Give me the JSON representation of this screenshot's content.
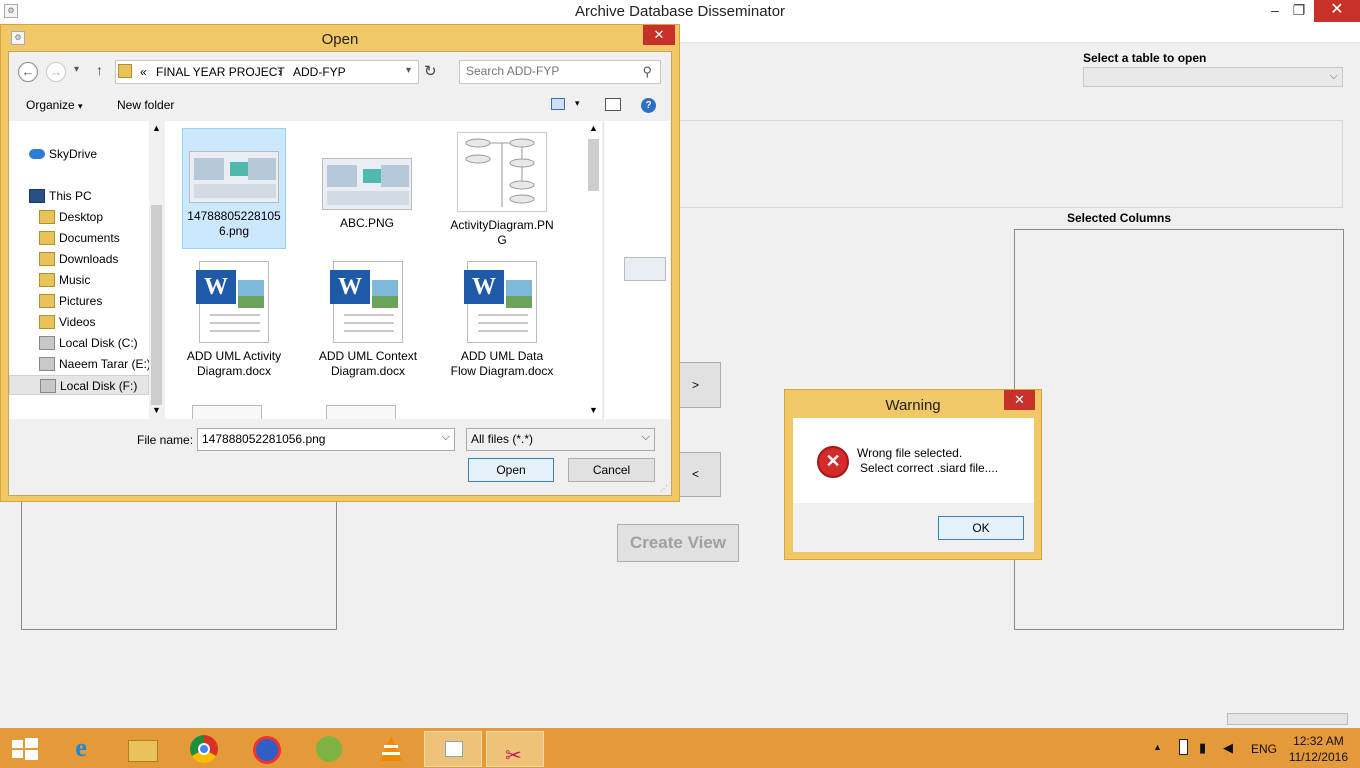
{
  "app": {
    "title": "Archive Database Disseminator",
    "select_table_label": "Select a table to open",
    "selected_columns_label": "Selected Columns",
    "move_right_label": ">",
    "move_left_label": "<",
    "create_view_label": "Create View"
  },
  "open_dialog": {
    "title": "Open",
    "breadcrumb": [
      "«",
      "FINAL YEAR PROJECT",
      "›",
      "ADD-FYP"
    ],
    "search_placeholder": "Search ADD-FYP",
    "organize_label": "Organize",
    "new_folder_label": "New folder",
    "nav_items": [
      "SkyDrive",
      "This PC",
      "Desktop",
      "Documents",
      "Downloads",
      "Music",
      "Pictures",
      "Videos",
      "Local Disk (C:)",
      "Naeem Tarar (E:)",
      "Local Disk (F:)"
    ],
    "files": [
      {
        "name": "147888052281056.png",
        "type": "png"
      },
      {
        "name": "ABC.PNG",
        "type": "png"
      },
      {
        "name": "ActivityDiagram.PNG",
        "type": "diagram"
      },
      {
        "name": "ADD UML Activity Diagram.docx",
        "type": "docx"
      },
      {
        "name": "ADD UML Context Diagram.docx",
        "type": "docx"
      },
      {
        "name": "ADD UML Data Flow Diagram.docx",
        "type": "docx"
      }
    ],
    "file_name_label": "File name:",
    "file_name_value": "147888052281056.png",
    "file_type_value": "All files (*.*)",
    "open_button": "Open",
    "cancel_button": "Cancel"
  },
  "warning_dialog": {
    "title": "Warning",
    "message_line1": "Wrong file selected.",
    "message_line2": "Select correct .siard file....",
    "ok_button": "OK"
  },
  "taskbar": {
    "language": "ENG",
    "time": "12:32 AM",
    "date": "11/12/2016"
  },
  "colors": {
    "dialog_frame": "#f0c868",
    "taskbar": "#e59a3a",
    "close_button": "#c7312a"
  }
}
